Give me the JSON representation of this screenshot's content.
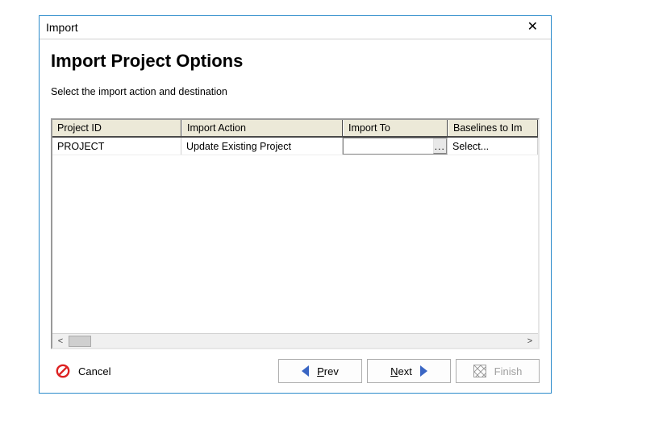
{
  "dialog": {
    "title": "Import",
    "heading": "Import Project Options",
    "subheading": "Select the import action and destination"
  },
  "grid": {
    "columns": [
      "Project  ID",
      "Import Action",
      "Import To",
      "Baselines to Im"
    ],
    "rows": [
      {
        "project_id": "PROJECT",
        "import_action": "Update Existing Project",
        "import_to": "",
        "baselines": "Select..."
      }
    ]
  },
  "buttons": {
    "cancel": "Cancel",
    "prev_prefix": "P",
    "prev_rest": "rev",
    "next_prefix": "N",
    "next_rest": "ext",
    "finish": "Finish",
    "ellipsis": "..."
  },
  "scroll": {
    "left_glyph": "<",
    "right_glyph": ">"
  }
}
